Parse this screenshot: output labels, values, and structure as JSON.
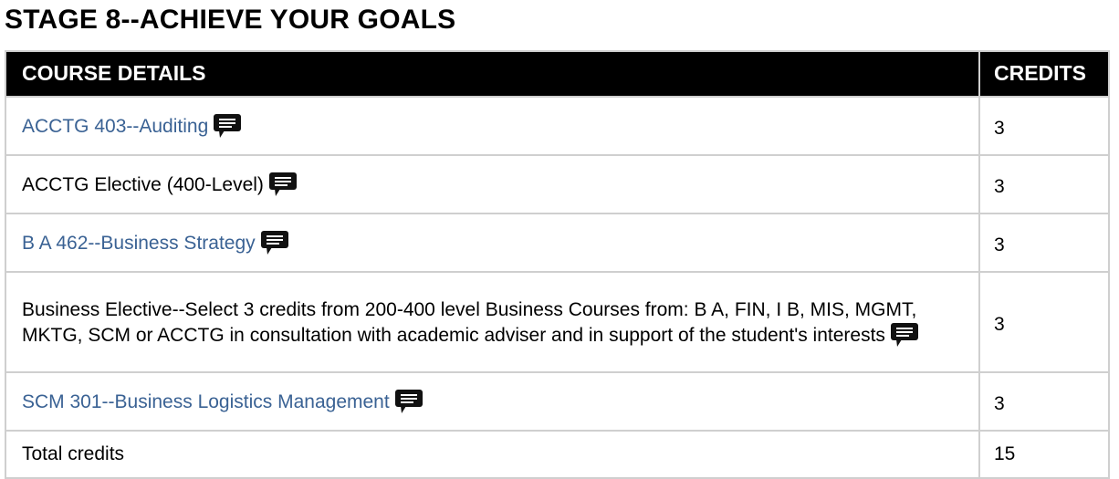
{
  "page": {
    "title": "STAGE 8--ACHIEVE YOUR GOALS"
  },
  "table": {
    "headers": {
      "course": "COURSE DETAILS",
      "credits": "CREDITS"
    },
    "rows": [
      {
        "course": "ACCTG 403--Auditing",
        "is_link": true,
        "credits": "3",
        "has_comment_icon": true
      },
      {
        "course": "ACCTG Elective (400-Level)",
        "is_link": false,
        "credits": "3",
        "has_comment_icon": true
      },
      {
        "course": "B A 462--Business Strategy",
        "is_link": true,
        "credits": "3",
        "has_comment_icon": true
      },
      {
        "course": "Business Elective--Select 3 credits from 200-400 level Business Courses from: B A, FIN, I B, MIS, MGMT, MKTG, SCM or ACCTG in consultation with academic adviser and in support of the student's interests",
        "is_link": false,
        "credits": "3",
        "has_comment_icon": true
      },
      {
        "course": "SCM 301--Business Logistics Management",
        "is_link": true,
        "credits": "3",
        "has_comment_icon": true
      }
    ],
    "total": {
      "label": "Total credits",
      "credits": "15"
    }
  },
  "icons": {
    "comment": "comment-icon"
  },
  "colors": {
    "header_bg": "#000000",
    "header_text": "#ffffff",
    "link": "#3a6294",
    "border": "#cfcfcf"
  }
}
